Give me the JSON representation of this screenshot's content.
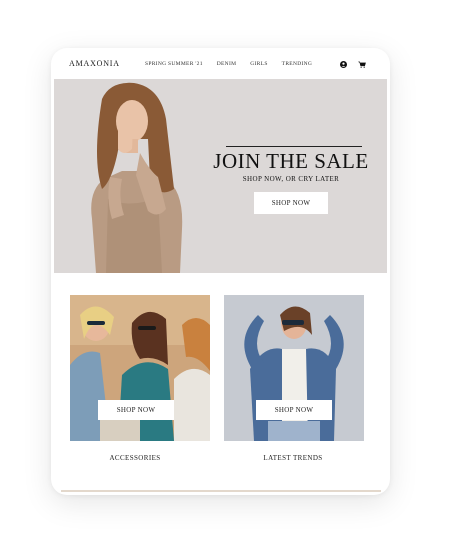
{
  "nav": {
    "brand": "AMAXONIA",
    "items": [
      "SPRING SUMMER '21",
      "DENIM",
      "GIRLS",
      "TRENDING"
    ],
    "icons": [
      "account-icon",
      "cart-icon"
    ]
  },
  "hero": {
    "title": "JOIN THE SALE",
    "subtitle": "SHOP NOW, OR CRY LATER",
    "button": "SHOP NOW"
  },
  "cards": [
    {
      "button": "SHOP NOW",
      "caption": "ACCESSORIES"
    },
    {
      "button": "SHOP NOW",
      "caption": "LATEST TRENDS"
    }
  ],
  "colors": {
    "hero_bg": "#dcd8d7",
    "button_bg": "#ffffff",
    "text": "#1a1a1a"
  }
}
